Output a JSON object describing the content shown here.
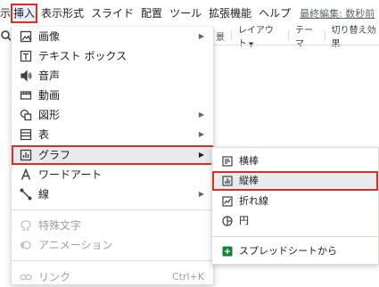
{
  "menubar": {
    "items": [
      {
        "label": "示",
        "name": "menubar-edit-cut"
      },
      {
        "label": "挿入",
        "name": "menubar-insert"
      },
      {
        "label": "表示形式",
        "name": "menubar-format"
      },
      {
        "label": "スライド",
        "name": "menubar-slide"
      },
      {
        "label": "配置",
        "name": "menubar-arrange"
      },
      {
        "label": "ツール",
        "name": "menubar-tools"
      },
      {
        "label": "拡張機能",
        "name": "menubar-extensions"
      },
      {
        "label": "ヘルプ",
        "name": "menubar-help"
      }
    ],
    "last_edit": "最終編集: 数秒前"
  },
  "toolbar": {
    "btn_background": "景",
    "btn_layout": "レイアウト",
    "btn_theme": "テーマ",
    "btn_transition": "切り替え効果"
  },
  "insert_menu": {
    "items": [
      {
        "label": "画像",
        "icon": "image-icon",
        "submenu": true
      },
      {
        "label": "テキスト ボックス",
        "icon": "text-box-icon"
      },
      {
        "label": "音声",
        "icon": "audio-icon"
      },
      {
        "label": "動画",
        "icon": "video-icon"
      },
      {
        "label": "図形",
        "icon": "shape-icon",
        "submenu": true
      },
      {
        "label": "表",
        "icon": "table-icon",
        "submenu": true
      },
      {
        "label": "グラフ",
        "icon": "chart-icon",
        "submenu": true,
        "highlighted": true
      },
      {
        "label": "ワードアート",
        "icon": "word-art-icon"
      },
      {
        "label": "線",
        "icon": "line-icon",
        "submenu": true
      },
      {
        "label": "特殊文字",
        "icon": "omega-icon",
        "disabled": true
      },
      {
        "label": "アニメーション",
        "icon": "animation-icon",
        "disabled": true
      },
      {
        "label": "リンク",
        "icon": "link-icon",
        "disabled": true,
        "shortcut": "Ctrl+K"
      }
    ]
  },
  "chart_submenu": {
    "items": [
      {
        "label": "横棒",
        "icon": "bar-chart-icon"
      },
      {
        "label": "縦棒",
        "icon": "column-chart-icon",
        "highlighted": true
      },
      {
        "label": "折れ線",
        "icon": "line-chart-icon"
      },
      {
        "label": "円",
        "icon": "pie-chart-icon"
      },
      {
        "label": "スプレッドシートから",
        "icon": "sheets-icon"
      }
    ]
  },
  "colors": {
    "highlight_outline": "#d93025",
    "sheets_green": "#188038"
  }
}
